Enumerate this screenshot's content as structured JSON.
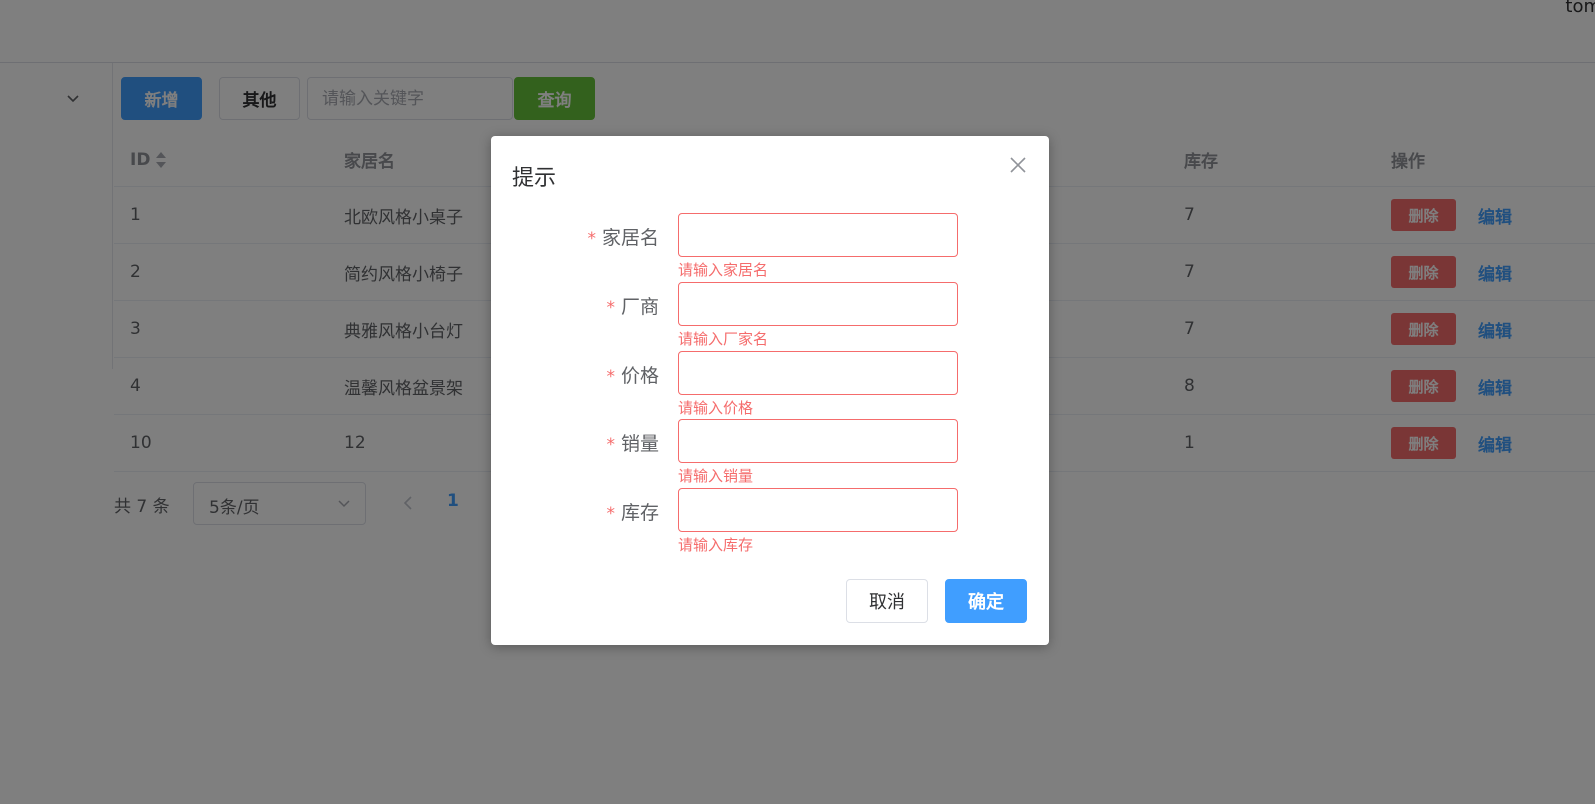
{
  "header": {
    "user": "tom"
  },
  "toolbar": {
    "add_label": "新增",
    "other_label": "其他",
    "search_placeholder": "请输入关键字",
    "query_label": "查询"
  },
  "table": {
    "columns": [
      {
        "key": "id",
        "label": "ID"
      },
      {
        "key": "name",
        "label": "家居名"
      },
      {
        "key": "maker",
        "label": ""
      },
      {
        "key": "price",
        "label": ""
      },
      {
        "key": "sales",
        "label": ""
      },
      {
        "key": "stock",
        "label": "库存"
      },
      {
        "key": "actions",
        "label": "操作"
      }
    ],
    "rows": [
      {
        "id": "1",
        "name": "北欧风格小桌子",
        "stock": "7"
      },
      {
        "id": "2",
        "name": "简约风格小椅子",
        "stock": "7"
      },
      {
        "id": "3",
        "name": "典雅风格小台灯",
        "stock": "7"
      },
      {
        "id": "4",
        "name": "温馨风格盆景架",
        "stock": "8"
      },
      {
        "id": "10",
        "name": "12",
        "stock": "1"
      }
    ],
    "delete_label": "删除",
    "edit_label": "编辑"
  },
  "pagination": {
    "total": "共 7 条",
    "page_size": "5条/页",
    "current_page": "1"
  },
  "dialog": {
    "title": "提示",
    "fields": [
      {
        "label": "家居名",
        "error": "请输入家居名"
      },
      {
        "label": "厂商",
        "error": "请输入厂家名"
      },
      {
        "label": "价格",
        "error": "请输入价格"
      },
      {
        "label": "销量",
        "error": "请输入销量"
      },
      {
        "label": "库存",
        "error": "请输入库存"
      }
    ],
    "required_mark": "*",
    "cancel_label": "取消",
    "confirm_label": "确定"
  },
  "colors": {
    "primary": "#409eff",
    "success": "#67c23a",
    "danger": "#f56c6c"
  }
}
